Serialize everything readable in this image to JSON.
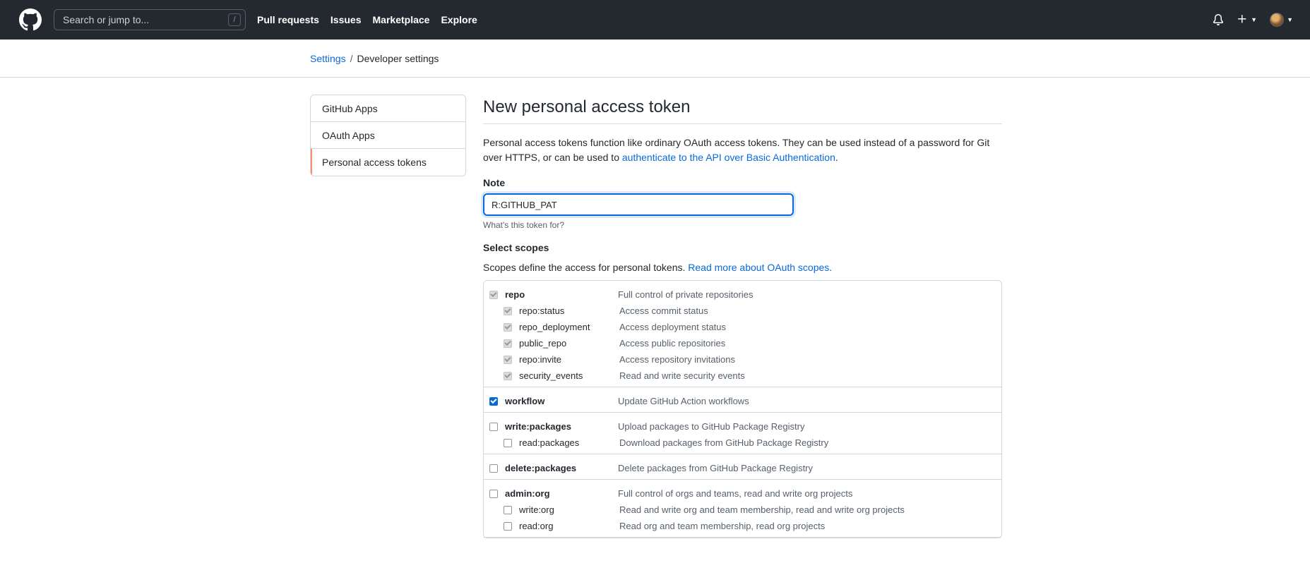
{
  "header": {
    "search_placeholder": "Search or jump to...",
    "search_shortcut": "/",
    "nav": [
      "Pull requests",
      "Issues",
      "Marketplace",
      "Explore"
    ]
  },
  "breadcrumb": {
    "settings": "Settings",
    "separator": "/",
    "current": "Developer settings"
  },
  "sidebar": {
    "items": [
      {
        "label": "GitHub Apps"
      },
      {
        "label": "OAuth Apps"
      },
      {
        "label": "Personal access tokens"
      }
    ]
  },
  "main": {
    "title": "New personal access token",
    "desc_text": "Personal access tokens function like ordinary OAuth access tokens. They can be used instead of a password for Git over HTTPS, or can be used to ",
    "desc_link": "authenticate to the API over Basic Authentication",
    "desc_end": ".",
    "note_label": "Note",
    "note_value": "R:GITHUB_PAT",
    "note_hint": "What's this token for?",
    "scopes_label": "Select scopes",
    "scopes_help": "Scopes define the access for personal tokens. ",
    "scopes_link": "Read more about OAuth scopes."
  },
  "scopes": [
    {
      "name": "repo",
      "desc": "Full control of private repositories",
      "state": "disabled",
      "children": [
        {
          "name": "repo:status",
          "desc": "Access commit status",
          "state": "disabled"
        },
        {
          "name": "repo_deployment",
          "desc": "Access deployment status",
          "state": "disabled"
        },
        {
          "name": "public_repo",
          "desc": "Access public repositories",
          "state": "disabled"
        },
        {
          "name": "repo:invite",
          "desc": "Access repository invitations",
          "state": "disabled"
        },
        {
          "name": "security_events",
          "desc": "Read and write security events",
          "state": "disabled"
        }
      ]
    },
    {
      "name": "workflow",
      "desc": "Update GitHub Action workflows",
      "state": "checked",
      "children": []
    },
    {
      "name": "write:packages",
      "desc": "Upload packages to GitHub Package Registry",
      "state": "unchecked",
      "children": [
        {
          "name": "read:packages",
          "desc": "Download packages from GitHub Package Registry",
          "state": "unchecked"
        }
      ]
    },
    {
      "name": "delete:packages",
      "desc": "Delete packages from GitHub Package Registry",
      "state": "unchecked",
      "children": []
    },
    {
      "name": "admin:org",
      "desc": "Full control of orgs and teams, read and write org projects",
      "state": "unchecked",
      "children": [
        {
          "name": "write:org",
          "desc": "Read and write org and team membership, read and write org projects",
          "state": "unchecked"
        },
        {
          "name": "read:org",
          "desc": "Read org and team membership, read org projects",
          "state": "unchecked"
        }
      ]
    }
  ],
  "colors": {
    "header_bg": "#24292f",
    "link": "#0969da",
    "active_marker": "#fd8c73"
  },
  "icons": {
    "logo": "github-logo-icon",
    "notifications": "bell-icon",
    "create": "plus-icon",
    "avatar": "avatar"
  }
}
